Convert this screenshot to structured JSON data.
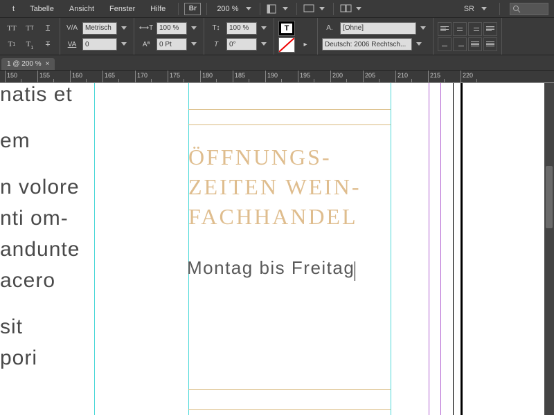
{
  "menu": {
    "items": [
      "t",
      "Tabelle",
      "Ansicht",
      "Fenster",
      "Hilfe"
    ],
    "bridge_icon": "Br",
    "zoom": "200 %",
    "sr": "SR"
  },
  "control": {
    "kerning": "Metrisch",
    "scale_h": "100 %",
    "scale_v": "100 %",
    "tracking": "0",
    "baseline": "0 Pt",
    "skew": "0°",
    "char_style": "[Ohne]",
    "lang": "Deutsch: 2006 Rechtsch..."
  },
  "tab": {
    "label": "1 @ 200 %",
    "close": "×"
  },
  "ruler": {
    "marks": [
      "150",
      "155",
      "160",
      "165",
      "170",
      "175",
      "180",
      "185",
      "190",
      "195",
      "200",
      "205",
      "210",
      "215",
      "220"
    ]
  },
  "doc": {
    "left_lines": [
      "natis et",
      "",
      "em",
      "",
      "n volore",
      "nti om-",
      "andunte",
      "acero",
      "",
      "sit",
      "pori"
    ],
    "heading": "ÖFFNUNGS-\nZEITEN WEIN-\nFACHHANDEL",
    "body": "Montag bis Freitag"
  }
}
